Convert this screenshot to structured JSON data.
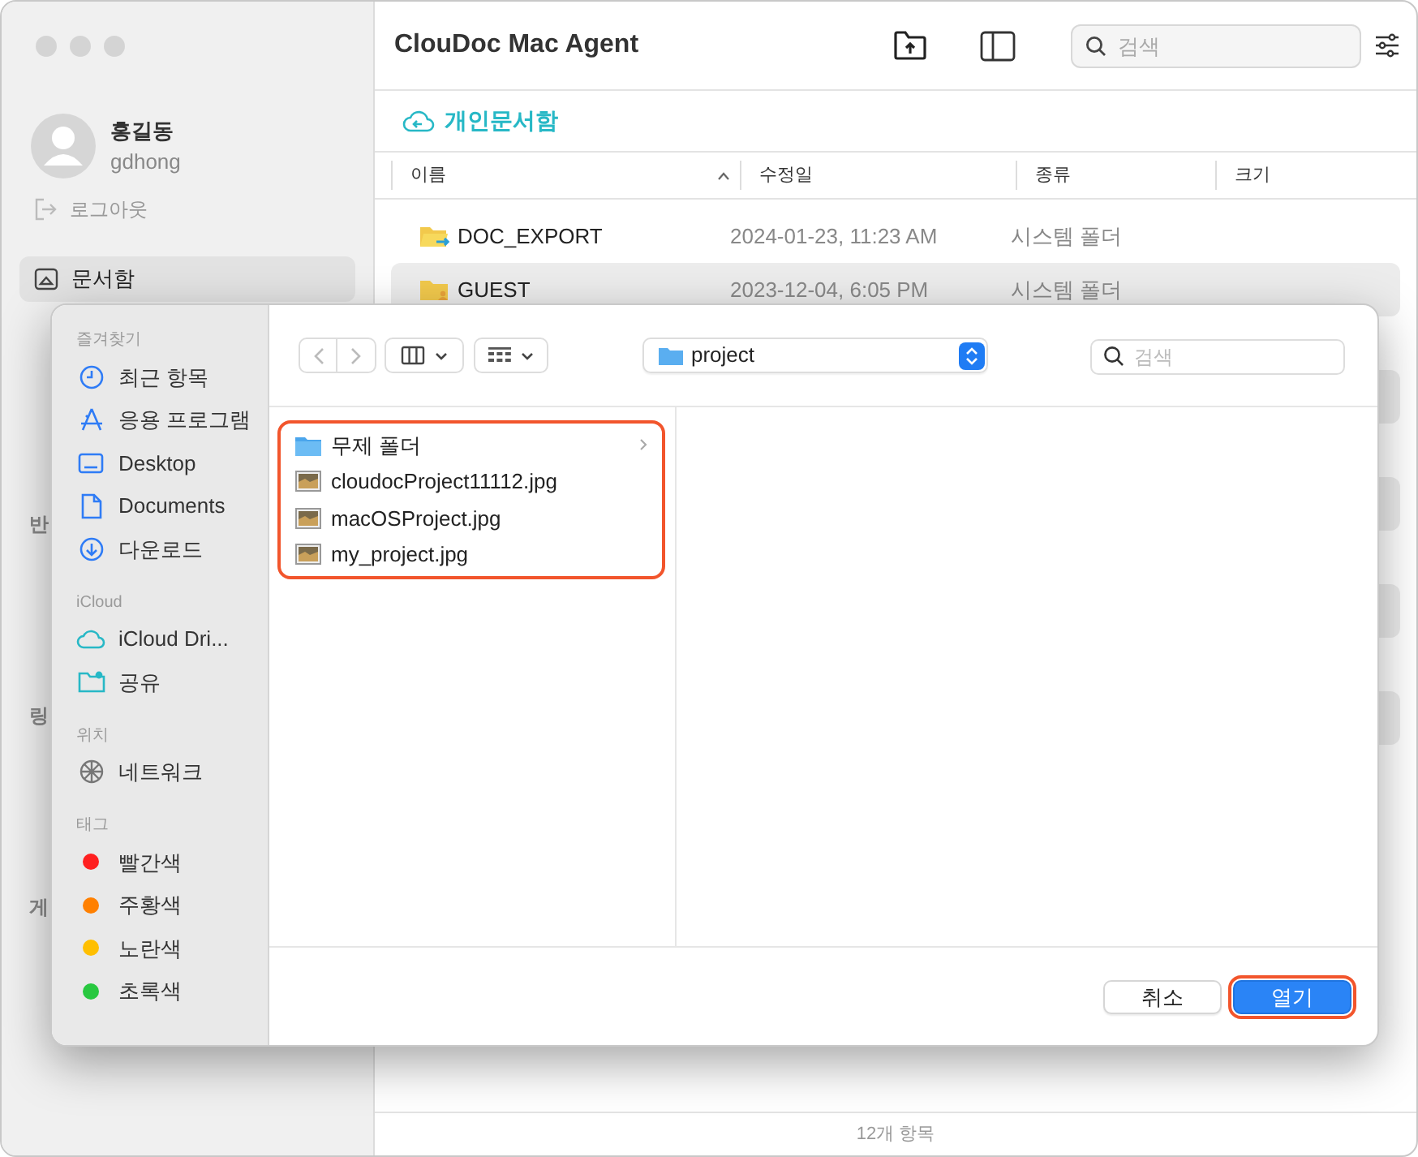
{
  "app": {
    "title": "ClouDoc Mac Agent",
    "user": {
      "name": "홍길동",
      "id": "gdhong"
    },
    "logout": "로그아웃",
    "sidebar": {
      "items": [
        {
          "label": "문서함",
          "selected": true
        }
      ],
      "section_headers": [
        "반",
        "링",
        "게"
      ]
    },
    "search": {
      "placeholder": "검색"
    },
    "breadcrumb": "개인문서함",
    "table": {
      "columns": [
        {
          "label": "이름",
          "sorted": true
        },
        {
          "label": "수정일",
          "sorted": false
        },
        {
          "label": "종류",
          "sorted": false
        },
        {
          "label": "크기",
          "sorted": false
        }
      ],
      "rows": [
        {
          "name": "DOC_EXPORT",
          "modified": "2024-01-23, 11:23 AM",
          "kind": "시스템 폴더",
          "selected": false
        },
        {
          "name": "GUEST",
          "modified": "2023-12-04, 6:05 PM",
          "kind": "시스템 폴더",
          "selected": true
        }
      ]
    },
    "status_bar": "12개 항목"
  },
  "dialog": {
    "sidebar": [
      {
        "header": "즐겨찾기",
        "items": [
          {
            "label": "최근 항목",
            "kind": "clock"
          },
          {
            "label": "응용 프로그램",
            "kind": "apps"
          },
          {
            "label": "Desktop",
            "kind": "desktop"
          },
          {
            "label": "Documents",
            "kind": "doc"
          },
          {
            "label": "다운로드",
            "kind": "download"
          }
        ]
      },
      {
        "header": "iCloud",
        "items": [
          {
            "label": "iCloud Dri...",
            "kind": "cloud"
          },
          {
            "label": "공유",
            "kind": "shared"
          }
        ]
      },
      {
        "header": "위치",
        "items": [
          {
            "label": "네트워크",
            "kind": "globe"
          }
        ]
      },
      {
        "header": "태그",
        "items": [
          {
            "label": "빨간색",
            "kind": "tag",
            "color": "#ff2020"
          },
          {
            "label": "주황색",
            "kind": "tag",
            "color": "#ff8000"
          },
          {
            "label": "노란색",
            "kind": "tag",
            "color": "#ffbf00"
          },
          {
            "label": "초록색",
            "kind": "tag",
            "color": "#28c840"
          }
        ]
      }
    ],
    "location": "project",
    "search": {
      "placeholder": "검색"
    },
    "files": {
      "highlighted": true,
      "items": [
        {
          "name": "무제 폴더",
          "kind": "folder"
        },
        {
          "name": "cloudocProject11112.jpg",
          "kind": "image"
        },
        {
          "name": "macOSProject.jpg",
          "kind": "image"
        },
        {
          "name": "my_project.jpg",
          "kind": "image"
        }
      ]
    },
    "buttons": [
      {
        "label": "취소",
        "kind": "cancel",
        "highlighted": false
      },
      {
        "label": "열기",
        "kind": "default",
        "highlighted": true
      }
    ]
  }
}
